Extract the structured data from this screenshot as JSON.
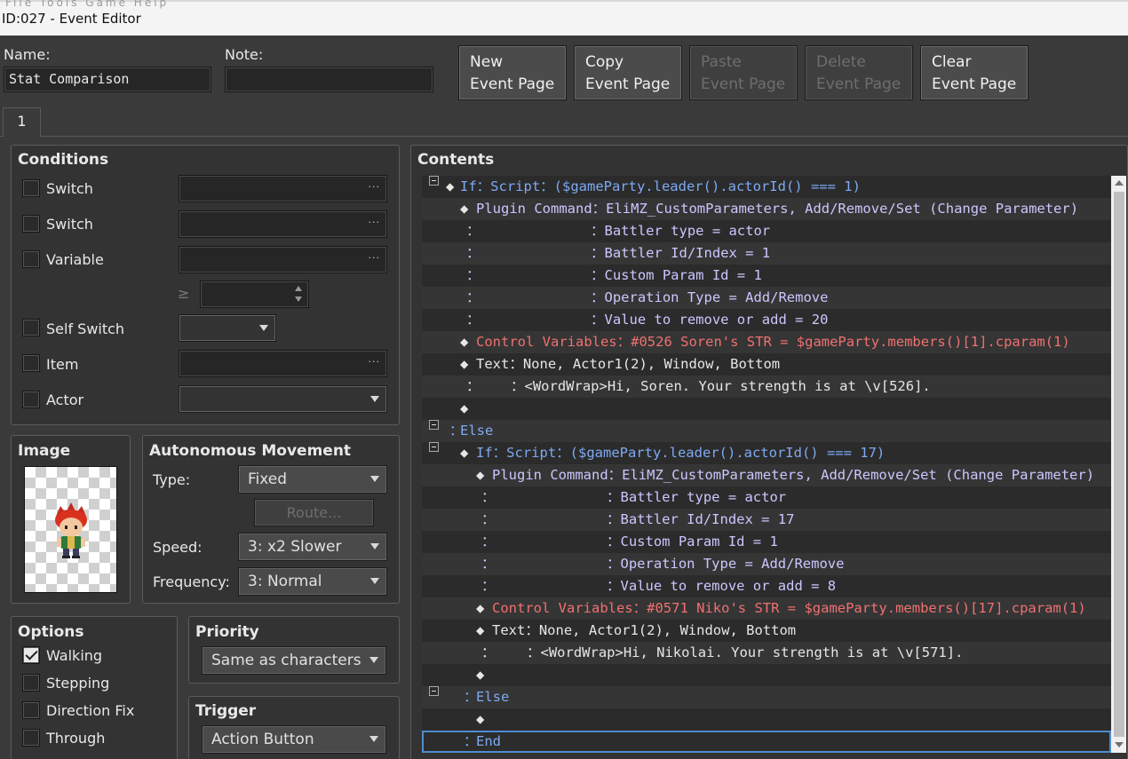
{
  "window": {
    "menu_ghost": "File  Tools  Game  Help",
    "title": "ID:027 - Event Editor"
  },
  "header": {
    "name_label": "Name:",
    "name_value": "Stat Comparison",
    "note_label": "Note:",
    "note_value": "",
    "buttons": [
      {
        "line1": "New",
        "line2": "Event Page",
        "enabled": true
      },
      {
        "line1": "Copy",
        "line2": "Event Page",
        "enabled": true
      },
      {
        "line1": "Paste",
        "line2": "Event Page",
        "enabled": false
      },
      {
        "line1": "Delete",
        "line2": "Event Page",
        "enabled": false
      },
      {
        "line1": "Clear",
        "line2": "Event Page",
        "enabled": true
      }
    ]
  },
  "tabs": [
    "1"
  ],
  "conditions": {
    "title": "Conditions",
    "switch1": "Switch",
    "switch2": "Switch",
    "variable": "Variable",
    "gte": "≥",
    "self_switch": "Self Switch",
    "item": "Item",
    "actor": "Actor",
    "ellipsis": "..."
  },
  "image": {
    "title": "Image",
    "character": "red-haired-hero-sprite"
  },
  "autonomous": {
    "title": "Autonomous Movement",
    "type_label": "Type:",
    "type_value": "Fixed",
    "route_label": "Route...",
    "speed_label": "Speed:",
    "speed_value": "3: x2 Slower",
    "freq_label": "Frequency:",
    "freq_value": "3: Normal"
  },
  "options": {
    "title": "Options",
    "items": [
      {
        "label": "Walking",
        "checked": true
      },
      {
        "label": "Stepping",
        "checked": false
      },
      {
        "label": "Direction Fix",
        "checked": false
      },
      {
        "label": "Through",
        "checked": false
      }
    ]
  },
  "priority": {
    "title": "Priority",
    "value": "Same as characters"
  },
  "trigger": {
    "title": "Trigger",
    "value": "Action Button"
  },
  "contents": {
    "title": "Contents",
    "rows": [
      {
        "fold": true,
        "parts": [
          {
            "t": "◆",
            "c": "white"
          },
          {
            "t": "If：Script：($gameParty.leader().actorId() === 1)",
            "c": "blue"
          }
        ]
      },
      {
        "parts": [
          {
            "t": "◆",
            "c": "white"
          },
          {
            "t": "Plugin Command：EliMZ_CustomParameters, Add/Remove/Set (Change Parameter)",
            "c": "lav"
          }
        ]
      },
      {
        "parts": [
          {
            "t": "：",
            "c": "lav"
          },
          {
            "t": "：Battler type = actor",
            "c": "lav"
          }
        ]
      },
      {
        "parts": [
          {
            "t": "：",
            "c": "lav"
          },
          {
            "t": "：Battler Id/Index = 1",
            "c": "lav"
          }
        ]
      },
      {
        "parts": [
          {
            "t": "：",
            "c": "lav"
          },
          {
            "t": "：Custom Param Id = 1",
            "c": "lav"
          }
        ]
      },
      {
        "parts": [
          {
            "t": "：",
            "c": "lav"
          },
          {
            "t": "：Operation Type = Add/Remove",
            "c": "lav"
          }
        ]
      },
      {
        "parts": [
          {
            "t": "：",
            "c": "lav"
          },
          {
            "t": "：Value to remove or add = 20",
            "c": "lav"
          }
        ]
      },
      {
        "parts": [
          {
            "t": "◆",
            "c": "white"
          },
          {
            "t": "Control Variables：#0526 Soren's STR = $gameParty.members()[1].cparam(1)",
            "c": "red"
          }
        ]
      },
      {
        "parts": [
          {
            "t": "◆",
            "c": "white"
          },
          {
            "t": "Text：None, Actor1(2), Window, Bottom",
            "c": "white"
          }
        ]
      },
      {
        "parts": [
          {
            "t": "：",
            "c": "white"
          },
          {
            "t": "：<WordWrap>Hi, Soren. Your strength is at \\v[526].",
            "c": "white"
          }
        ]
      },
      {
        "parts": [
          {
            "t": "◆",
            "c": "white"
          }
        ]
      },
      {
        "fold": true,
        "parts": [
          {
            "t": "：",
            "c": "blue"
          },
          {
            "t": "Else",
            "c": "blue"
          }
        ]
      },
      {
        "fold": true,
        "parts": [
          {
            "t": "◆",
            "c": "white"
          },
          {
            "t": "If：Script：($gameParty.leader().actorId() === 17)",
            "c": "blue"
          }
        ]
      },
      {
        "parts": [
          {
            "t": "◆",
            "c": "white"
          },
          {
            "t": "Plugin Command：EliMZ_CustomParameters, Add/Remove/Set (Change Parameter)",
            "c": "lav"
          }
        ]
      },
      {
        "parts": [
          {
            "t": "：",
            "c": "lav"
          },
          {
            "t": "：Battler type = actor",
            "c": "lav"
          }
        ]
      },
      {
        "parts": [
          {
            "t": "：",
            "c": "lav"
          },
          {
            "t": "：Battler Id/Index = 17",
            "c": "lav"
          }
        ]
      },
      {
        "parts": [
          {
            "t": "：",
            "c": "lav"
          },
          {
            "t": "：Custom Param Id = 1",
            "c": "lav"
          }
        ]
      },
      {
        "parts": [
          {
            "t": "：",
            "c": "lav"
          },
          {
            "t": "：Operation Type = Add/Remove",
            "c": "lav"
          }
        ]
      },
      {
        "parts": [
          {
            "t": "：",
            "c": "lav"
          },
          {
            "t": "：Value to remove or add = 8",
            "c": "lav"
          }
        ]
      },
      {
        "parts": [
          {
            "t": "◆",
            "c": "white"
          },
          {
            "t": "Control Variables：#0571 Niko's STR = $gameParty.members()[17].cparam(1)",
            "c": "red"
          }
        ]
      },
      {
        "parts": [
          {
            "t": "◆",
            "c": "white"
          },
          {
            "t": "Text：None, Actor1(2), Window, Bottom",
            "c": "white"
          }
        ]
      },
      {
        "parts": [
          {
            "t": "：",
            "c": "white"
          },
          {
            "t": "：<WordWrap>Hi, Nikolai. Your strength is at \\v[571].",
            "c": "white"
          }
        ]
      },
      {
        "parts": [
          {
            "t": "◆",
            "c": "white"
          }
        ]
      },
      {
        "fold": true,
        "parts": [
          {
            "t": "：",
            "c": "blue"
          },
          {
            "t": "Else",
            "c": "blue"
          }
        ]
      },
      {
        "parts": [
          {
            "t": "◆",
            "c": "white"
          }
        ]
      },
      {
        "selected": true,
        "parts": [
          {
            "t": "：",
            "c": "blue"
          },
          {
            "t": "End",
            "c": "blue"
          }
        ]
      }
    ]
  }
}
